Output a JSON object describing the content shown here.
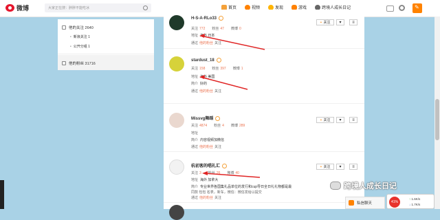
{
  "header": {
    "logo_text": "微博",
    "search_placeholder": "大家正在搜：胖胖不能吃冰",
    "nav": [
      {
        "label": "首页",
        "icon": "home-icon"
      },
      {
        "label": "视频",
        "icon": "video-icon"
      },
      {
        "label": "发现",
        "icon": "discover-icon"
      },
      {
        "label": "游戏",
        "icon": "game-icon"
      },
      {
        "label": "跨境人成长日记",
        "icon": "user-icon"
      }
    ]
  },
  "sidebar": {
    "following": "他的关注 2640",
    "sub_items": [
      "新浪关注 1",
      "公开分组 1"
    ],
    "fans": "他的粉丝 31716"
  },
  "entries": [
    {
      "nickname": "H-S-A-RLo33",
      "stats": {
        "follow_label": "关注",
        "follow": "772",
        "fans_label": "粉丝",
        "fans": "47",
        "weibo_label": "微博",
        "weibo": "0"
      },
      "address_label": "地址",
      "address": "海外 日本",
      "via_text": "通过",
      "via_link": "他的粉丝",
      "via_suffix": "关注"
    },
    {
      "nickname": "stardust_18",
      "stats": {
        "follow_label": "关注",
        "follow": "158",
        "fans_label": "粉丝",
        "fans": "397",
        "weibo_label": "微博",
        "weibo": "1"
      },
      "address_label": "地址",
      "address": "海外 美国",
      "intro_label": "简介",
      "intro": "好的",
      "via_text": "通过",
      "via_link": "他的粉丝",
      "via_suffix": "关注"
    },
    {
      "nickname": "Missvg舞蹈",
      "stats": {
        "follow_label": "关注",
        "follow": "4874",
        "fans_label": "粉丝",
        "fans": "4",
        "weibo_label": "微博",
        "weibo": "289"
      },
      "address_label": "地址",
      "address": "",
      "intro_label": "简介",
      "intro": "内容视频加微信",
      "via_text": "通过",
      "via_link": "他的粉丝",
      "via_suffix": "关注"
    },
    {
      "nickname": "杭初客的唱礼汇",
      "stats": {
        "follow_label": "关注",
        "follow": "3",
        "fans_label": "粉丝",
        "fans": "26",
        "weibo_label": "微博",
        "weibo": "40"
      },
      "address_label": "地址",
      "address": "海外 加拿大",
      "intro_label": "简介",
      "intro": "专业世界各国集礼品单位的发行和cup导日全日礼礼物都是最",
      "intro2": "同款 包包 名表，新车，微信：微信发给以提交",
      "via_text": "通过",
      "via_link": "他的粉丝",
      "via_suffix": "关注"
    }
  ],
  "buttons": {
    "follow": "关注",
    "more": "▾",
    "menu": "≡"
  },
  "watermark": "跨境人成长日记",
  "chat": "私信聊天",
  "speed_widget": {
    "cpu": "41%",
    "up": "1.6K/s",
    "down": "1.7K/s"
  },
  "colors": {
    "accent": "#ff8200",
    "stat_num": "#eb7350",
    "arrow": "#e02424",
    "background": "#a9d2e6"
  }
}
